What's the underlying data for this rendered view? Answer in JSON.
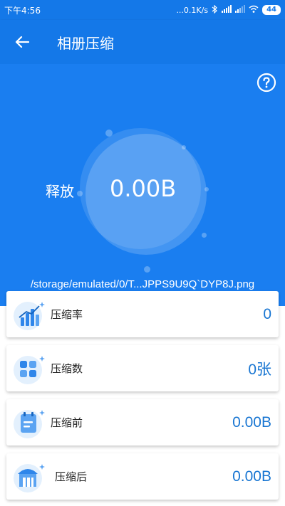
{
  "status_bar": {
    "time": "下午4:56",
    "network_speed": "...0.1K/s",
    "battery": "44"
  },
  "app_bar": {
    "title": "相册压缩"
  },
  "hero": {
    "release_label": "释放",
    "release_value": "0.00B",
    "path": "/storage/emulated/0/T...JPPS9U9Q`DYP8J.png"
  },
  "stats": [
    {
      "label": "压缩率",
      "value": "0",
      "icon": "bar-chart-icon"
    },
    {
      "label": "压缩数",
      "value": "0张",
      "icon": "grid-apps-icon"
    },
    {
      "label": "压缩前",
      "value": "0.00B",
      "icon": "calendar-doc-icon"
    },
    {
      "label": "压缩后",
      "value": "0.00B",
      "icon": "storehouse-icon"
    }
  ],
  "colors": {
    "primary": "#1478e8",
    "hero": "#1a7ef0",
    "value_text": "#1976d2"
  }
}
